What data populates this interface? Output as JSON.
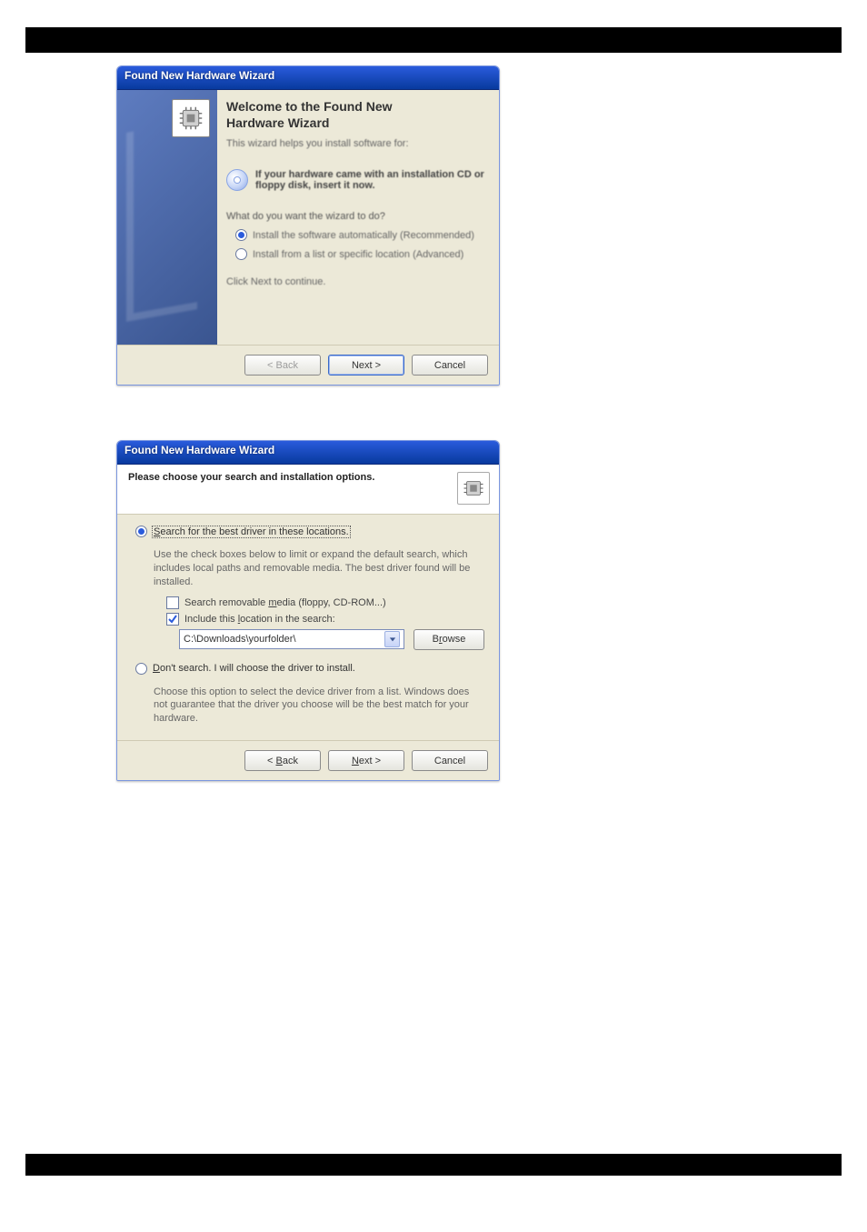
{
  "step1": {
    "title": "Found New Hardware Wizard",
    "welcome_line1": "Welcome to the Found New",
    "welcome_line2": "Hardware Wizard",
    "intro": "This wizard helps you install software for:",
    "cd_hint": "If your hardware came with an installation CD or floppy disk, insert it now.",
    "question": "What do you want the wizard to do?",
    "opt_auto": "Install the software automatically (Recommended)",
    "opt_list": "Install from a list or specific location (Advanced)",
    "continue_hint": "Click Next to continue.",
    "back": "< Back",
    "next": "Next >",
    "cancel": "Cancel"
  },
  "step2": {
    "title": "Found New Hardware Wizard",
    "heading": "Please choose your search and installation options.",
    "opt_search_label_pre": "S",
    "opt_search_label": "earch for the best driver in these locations.",
    "opt_search_desc": "Use the check boxes below to limit or expand the default search, which includes local paths and removable media. The best driver found will be installed.",
    "chk_removable_pre": "Search removable ",
    "chk_removable_mn": "m",
    "chk_removable_post": "edia (floppy, CD-ROM...)",
    "chk_include_pre": "Include this ",
    "chk_include_mn": "l",
    "chk_include_post": "ocation in the search:",
    "path_value": "C:\\Downloads\\yourfolder\\",
    "browse_pre": "B",
    "browse_mn": "r",
    "browse_post": "owse",
    "opt_dont_pre": "D",
    "opt_dont_post": "on't search. I will choose the driver to install.",
    "opt_dont_desc": "Choose this option to select the device driver from a list.  Windows does not guarantee that the driver you choose will be the best match for your hardware.",
    "back_pre": "< ",
    "back_mn": "B",
    "back_post": "ack",
    "next_pre": "",
    "next_mn": "N",
    "next_post": "ext >",
    "cancel": "Cancel"
  }
}
